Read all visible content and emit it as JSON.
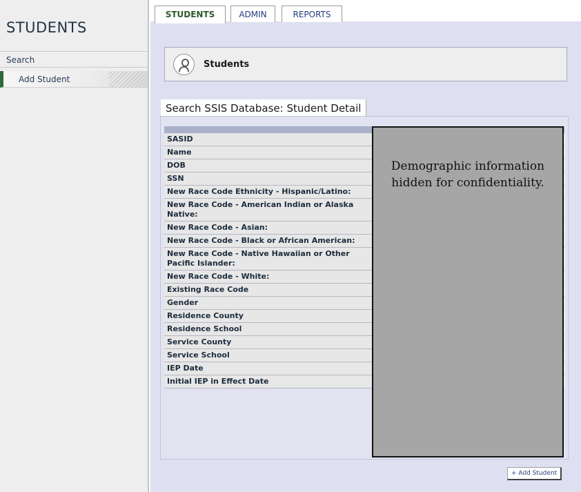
{
  "sidebar": {
    "title": "STUDENTS",
    "items": [
      {
        "label": "Search"
      },
      {
        "label": "Add Student"
      }
    ]
  },
  "tabs": [
    {
      "label": "STUDENTS",
      "active": true
    },
    {
      "label": "ADMIN",
      "active": false
    },
    {
      "label": "REPORTS",
      "active": false
    }
  ],
  "header": {
    "icon": "user-icon",
    "title": "Students"
  },
  "section": {
    "title": "Search SSIS Database: Student Detail"
  },
  "fields": [
    {
      "label": "SASID"
    },
    {
      "label": "Name"
    },
    {
      "label": "DOB"
    },
    {
      "label": "SSN"
    },
    {
      "label": "New Race Code Ethnicity - Hispanic/Latino:"
    },
    {
      "label": "New Race Code - American Indian or Alaska Native:"
    },
    {
      "label": "New Race Code - Asian:"
    },
    {
      "label": "New Race Code - Black or African American:"
    },
    {
      "label": "New Race Code - Native Hawaiian or Other Pacific Islander:"
    },
    {
      "label": "New Race Code - White:"
    },
    {
      "label": "Existing Race Code"
    },
    {
      "label": "Gender"
    },
    {
      "label": "Residence County"
    },
    {
      "label": "Residence School"
    },
    {
      "label": "Service County"
    },
    {
      "label": "Service School"
    },
    {
      "label": "IEP Date"
    },
    {
      "label": "Initial IEP in Effect Date"
    }
  ],
  "overlay": {
    "text": "Demographic information hidden for confidentiality."
  },
  "actions": {
    "add_student_label": "+ Add Student"
  },
  "colors": {
    "accent_green": "#2f6b3a",
    "main_bg": "#dedff0",
    "table_header": "#a9b1c8",
    "overlay_gray": "#a6a6a6"
  }
}
